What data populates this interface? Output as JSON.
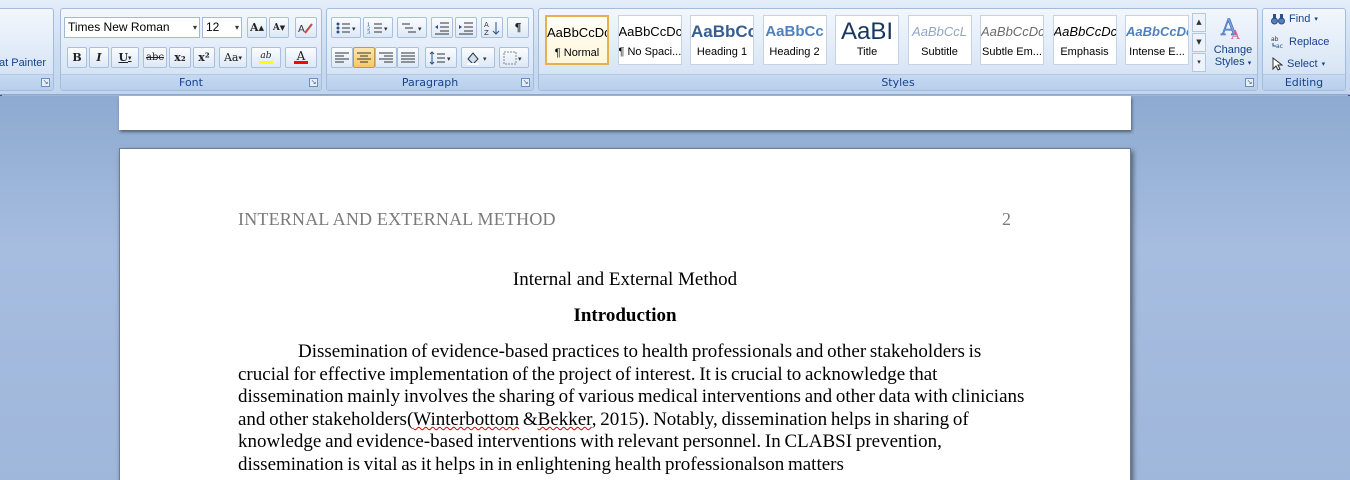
{
  "clipboard": {
    "format_painter_label": "at Painter"
  },
  "font_group": {
    "label": "Font",
    "font_name": "Times New Roman",
    "font_size": "12",
    "grow_label": "A",
    "shrink_label": "A",
    "bold": "B",
    "italic": "I",
    "underline": "U",
    "strike": "abc",
    "subscript": "x₂",
    "superscript": "x²",
    "change_case": "Aa",
    "highlight": "ab",
    "font_color": "A"
  },
  "paragraph_group": {
    "label": "Paragraph",
    "show_marks": "¶"
  },
  "styles_group": {
    "label": "Styles",
    "tiles": [
      {
        "sample": "AaBbCcDc",
        "name": "¶ Normal"
      },
      {
        "sample": "AaBbCcDc",
        "name": "¶ No Spaci..."
      },
      {
        "sample": "AaBbCc",
        "name": "Heading 1"
      },
      {
        "sample": "AaBbCc",
        "name": "Heading 2"
      },
      {
        "sample": "AaBI",
        "name": "Title"
      },
      {
        "sample": "AaBbCcL",
        "name": "Subtitle"
      },
      {
        "sample": "AaBbCcDc",
        "name": "Subtle Em..."
      },
      {
        "sample": "AaBbCcDc",
        "name": "Emphasis"
      },
      {
        "sample": "AaBbCcDc",
        "name": "Intense E..."
      }
    ],
    "change_styles_line1": "Change",
    "change_styles_line2": "Styles"
  },
  "editing_group": {
    "label": "Editing",
    "find": "Find",
    "replace": "Replace",
    "select": "Select"
  },
  "document": {
    "running_head": "INTERNAL AND EXTERNAL METHOD",
    "page_number": "2",
    "title": "Internal and External Method",
    "heading": "Introduction",
    "para_part1": "Dissemination of evidence-based practices to health professionals and other stakeholders is crucial for effective implementation of the project of interest. It is crucial to acknowledge that dissemination mainly involves the sharing of various medical interventions and other data with clinicians and other stakeholders(",
    "para_citation": "Winterbottom",
    "para_part2": " &",
    "para_citation2": "Bekker",
    "para_part3": ", 2015). Notably, dissemination helps in sharing of knowledge and evidence-based interventions with relevant personnel. In CLABSI prevention, dissemination is vital as it helps in in enlightening health ",
    "para_typo": "professionalson",
    "para_part4": " matters"
  },
  "colors": {
    "ribbon_text": "#15428b",
    "selected_style": "#e5b14f",
    "font_color_bar": "#ff0000",
    "highlight_bar": "#ffff00"
  }
}
